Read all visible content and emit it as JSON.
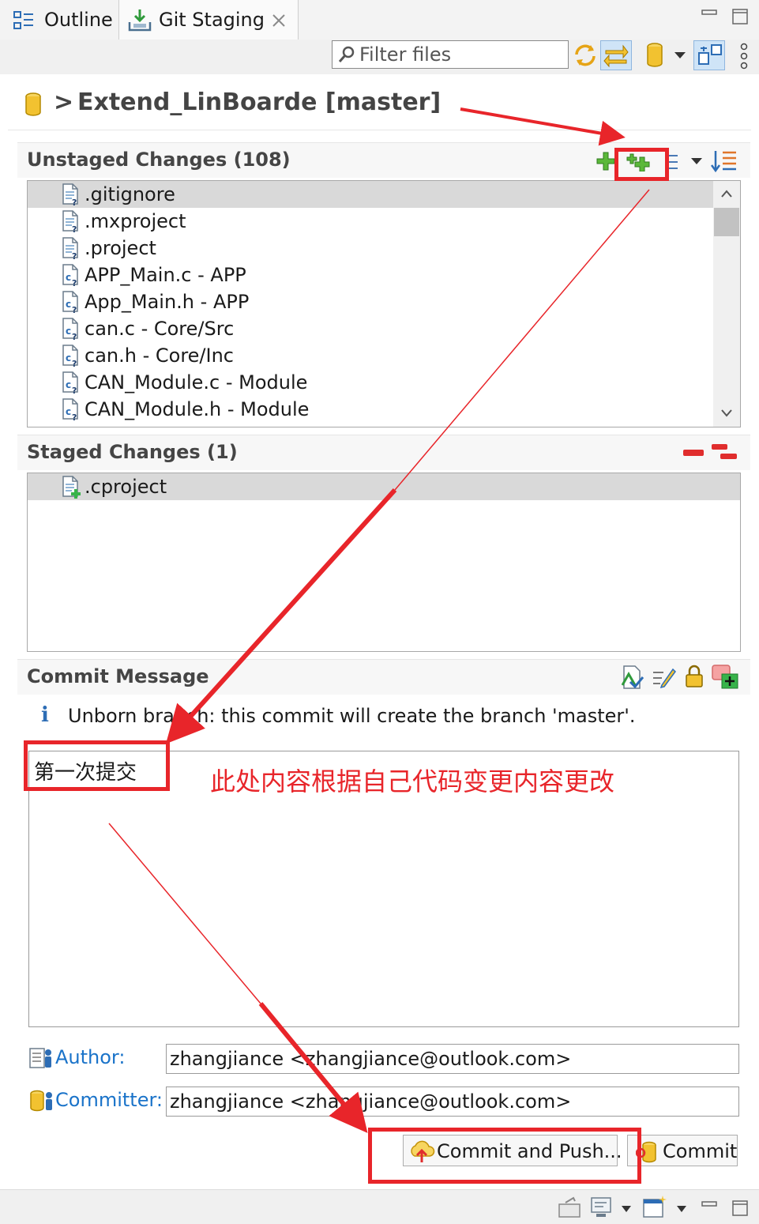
{
  "tabs": [
    {
      "label": "Outline",
      "icon": "outline-icon"
    },
    {
      "label": "Git Staging",
      "icon": "git-staging-icon",
      "close_icon": "close-icon"
    }
  ],
  "toolbar": {
    "filter_placeholder": "Filter files"
  },
  "repository": {
    "prefix": ">",
    "title": "Extend_LinBoarde [master]"
  },
  "unstaged": {
    "title": "Unstaged Changes (108)",
    "files": [
      {
        "label": ".gitignore",
        "selected": true
      },
      {
        "label": ".mxproject",
        "selected": false
      },
      {
        "label": ".project",
        "selected": false
      },
      {
        "label": "APP_Main.c - APP",
        "selected": false
      },
      {
        "label": "App_Main.h - APP",
        "selected": false
      },
      {
        "label": "can.c - Core/Src",
        "selected": false
      },
      {
        "label": "can.h - Core/Inc",
        "selected": false
      },
      {
        "label": "CAN_Module.c - Module",
        "selected": false
      },
      {
        "label": "CAN_Module.h - Module",
        "selected": false
      }
    ]
  },
  "staged": {
    "title": "Staged Changes (1)",
    "files": [
      {
        "label": ".cproject",
        "selected": true
      }
    ]
  },
  "commit": {
    "title": "Commit Message",
    "info": "Unborn branch: this commit will create the branch 'master'.",
    "message": "第一次提交",
    "annotation": "此处内容根据自己代码变更内容更改",
    "author_label": "Author:",
    "author_value": "zhangjiance <zhangjiance@outlook.com>",
    "committer_label": "Committer:",
    "committer_value": "zhangjiance <zhangjiance@outlook.com>",
    "commit_push_label": "Commit and Push...",
    "commit_label": "Commit"
  },
  "colors": {
    "annotation_red": "#e8252a",
    "label_blue": "#1a73c9",
    "selection_gray": "#d9d9d9"
  }
}
